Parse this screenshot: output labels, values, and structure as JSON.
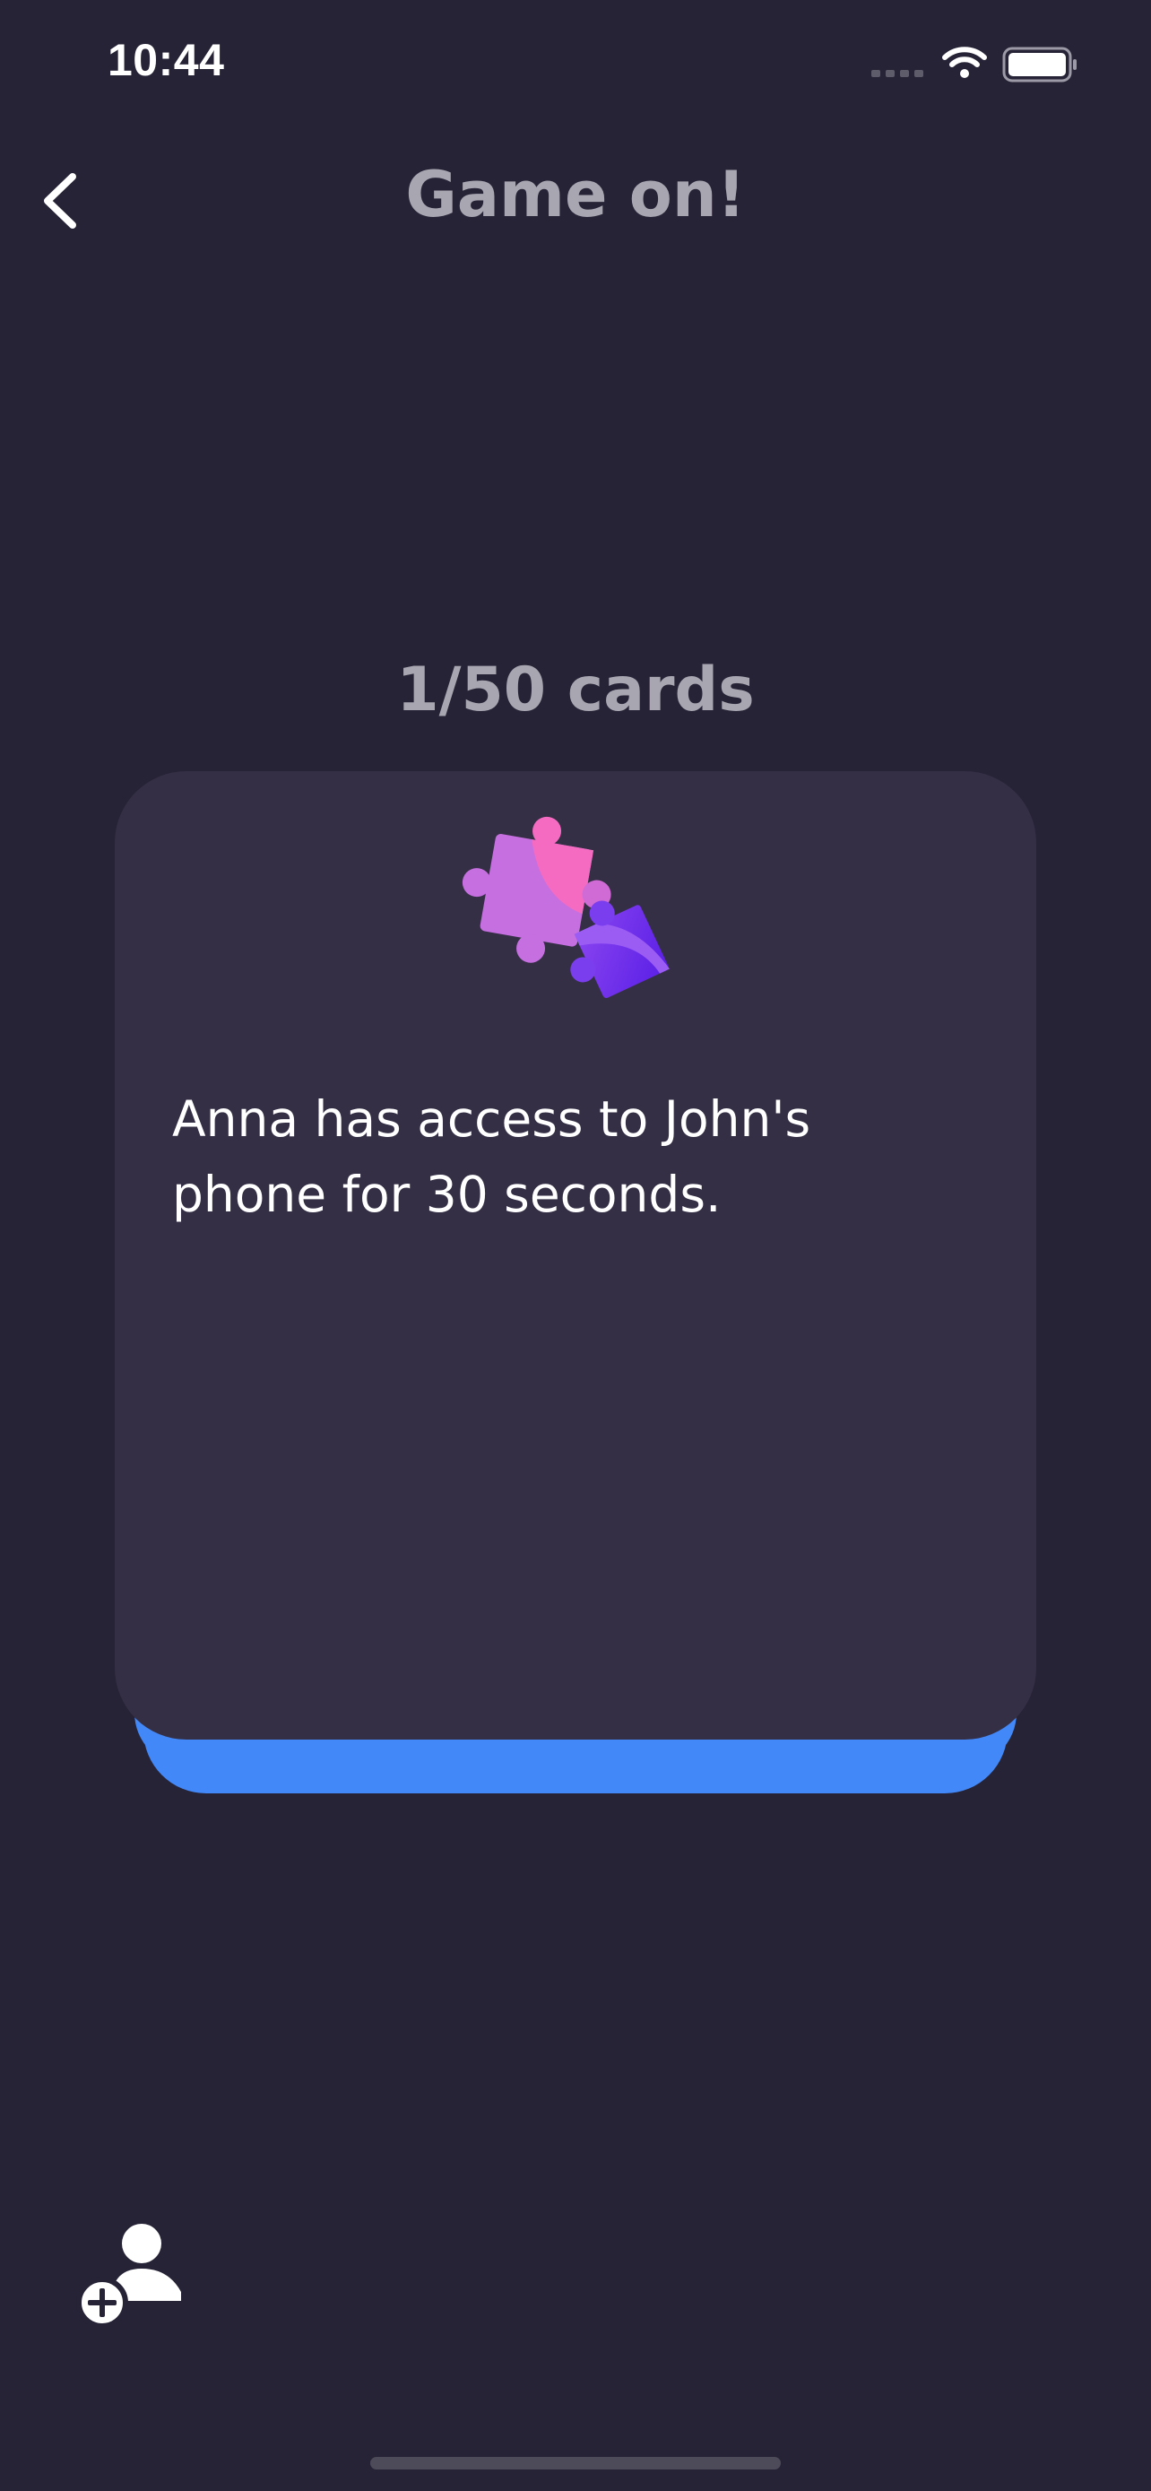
{
  "status_bar": {
    "time": "10:44"
  },
  "nav": {
    "title": "Game on!"
  },
  "game": {
    "counter": "1/50 cards",
    "card_text": "Anna has access to John's phone for 30 seconds."
  },
  "colors": {
    "background": "#272336",
    "card": "#352f45",
    "card_underlay": "#4388f8",
    "title_text": "#a8a6b1",
    "body_text": "#ffffff",
    "puzzle_pink": "#f36fc5",
    "puzzle_violet": "#c56fe0",
    "puzzle_purple": "#6a28ee"
  },
  "icons": {
    "back": "chevron-left-icon",
    "card": "puzzle-pieces-icon",
    "add_player": "add-person-icon"
  }
}
